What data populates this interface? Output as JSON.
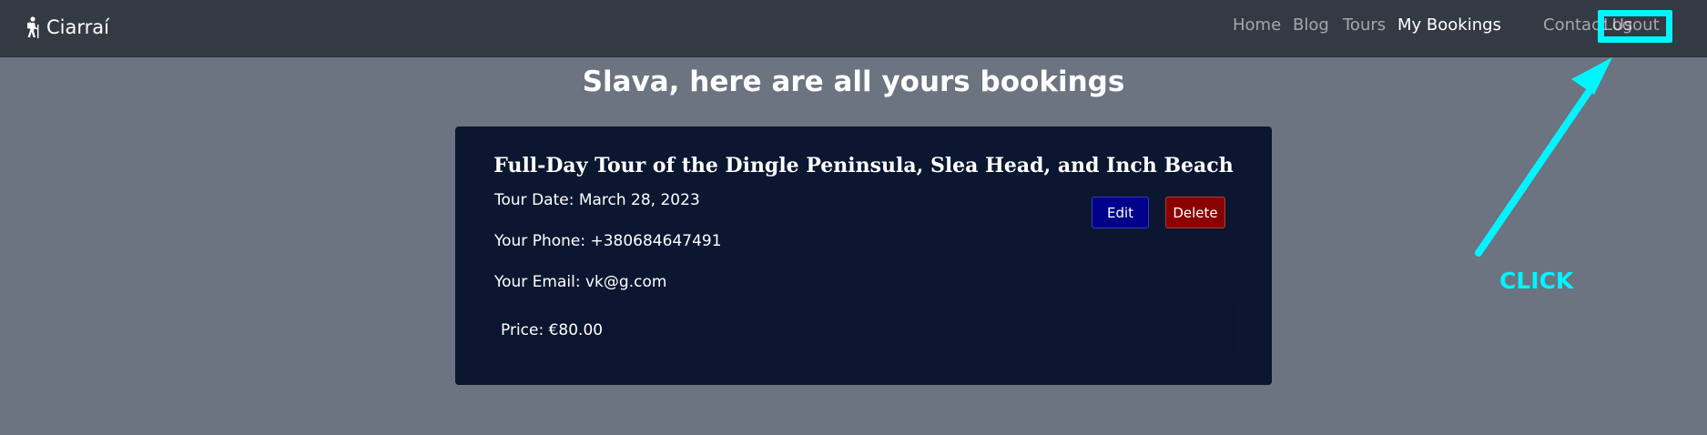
{
  "nav": {
    "brand": "Ciarraí",
    "links": [
      "Home",
      "Blog",
      "Tours",
      "My Bookings",
      "Contact Us",
      "Logout"
    ]
  },
  "page": {
    "title": "Slava, here are all yours bookings"
  },
  "booking": {
    "tour_name": "Full-Day Tour of the Dingle Peninsula, Slea Head, and Inch Beach",
    "tour_date": "Tour Date: March 28, 2023",
    "phone": "Your Phone: +380684647491",
    "email": "Your Email: vk@g.com",
    "price": "Price: €80.00",
    "edit_label": "Edit",
    "delete_label": "Delete"
  },
  "annotation": {
    "label": "CLICK",
    "color": "#00f5ff"
  },
  "colors": {
    "navbar": "#343a44",
    "background": "#6c7381",
    "card": "#0b1730",
    "edit": "#00008b",
    "delete": "#8b0000"
  }
}
